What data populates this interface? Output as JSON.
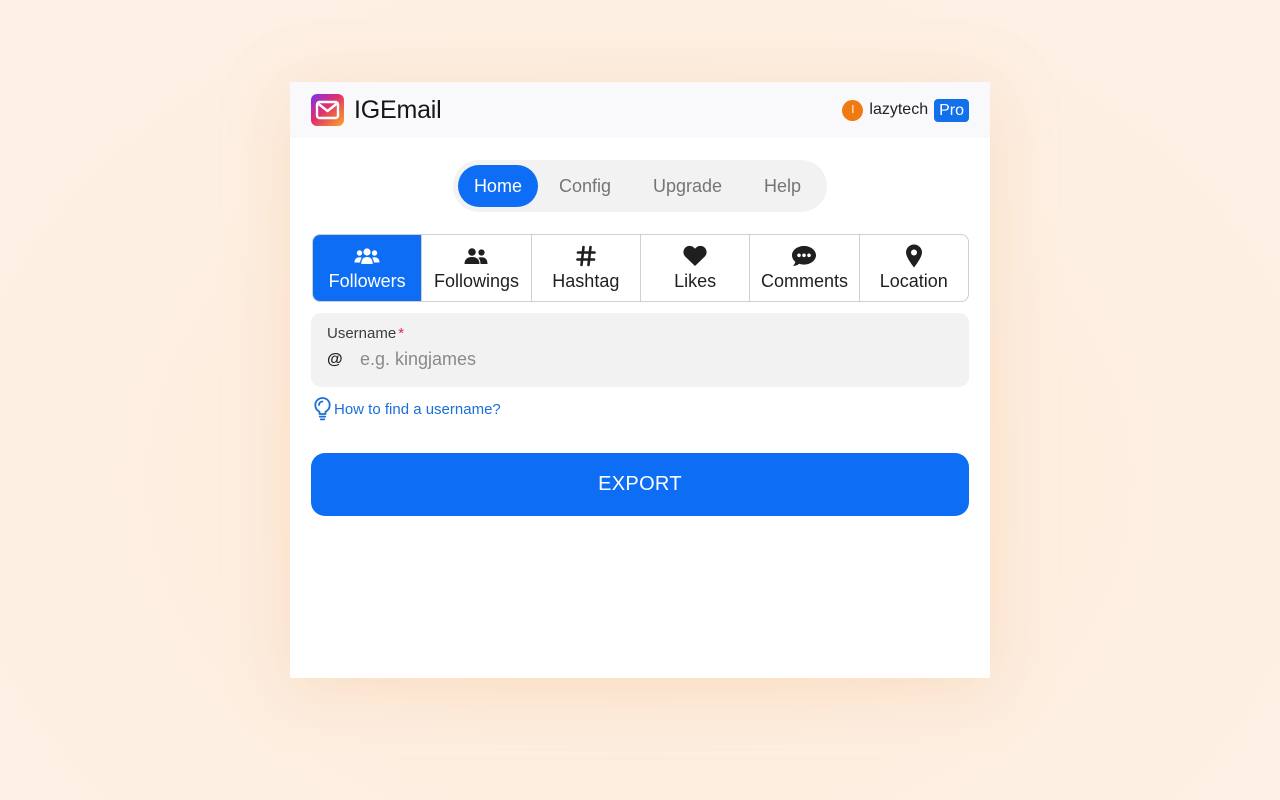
{
  "header": {
    "app_name": "IGEmail",
    "user": {
      "avatar_initial": "l",
      "username": "lazytech",
      "plan_badge": "Pro"
    }
  },
  "nav": {
    "items": [
      {
        "label": "Home",
        "active": true
      },
      {
        "label": "Config",
        "active": false
      },
      {
        "label": "Upgrade",
        "active": false
      },
      {
        "label": "Help",
        "active": false
      }
    ]
  },
  "source_tabs": [
    {
      "label": "Followers",
      "icon": "users-icon",
      "active": true
    },
    {
      "label": "Followings",
      "icon": "user-friends-icon",
      "active": false
    },
    {
      "label": "Hashtag",
      "icon": "hashtag-icon",
      "active": false
    },
    {
      "label": "Likes",
      "icon": "heart-icon",
      "active": false
    },
    {
      "label": "Comments",
      "icon": "comment-dots-icon",
      "active": false
    },
    {
      "label": "Location",
      "icon": "map-pin-icon",
      "active": false
    }
  ],
  "username_field": {
    "label": "Username",
    "required_mark": "*",
    "prefix": "@",
    "placeholder": "e.g. kingjames",
    "value": ""
  },
  "help_link": {
    "label": "How to find a username?",
    "icon": "lightbulb-icon"
  },
  "export_button": {
    "label": "EXPORT"
  },
  "colors": {
    "accent": "#0d6ef5",
    "avatar": "#f07a12",
    "link": "#1a6fd8",
    "required": "#e0284e",
    "background": "#fdf1e6"
  }
}
